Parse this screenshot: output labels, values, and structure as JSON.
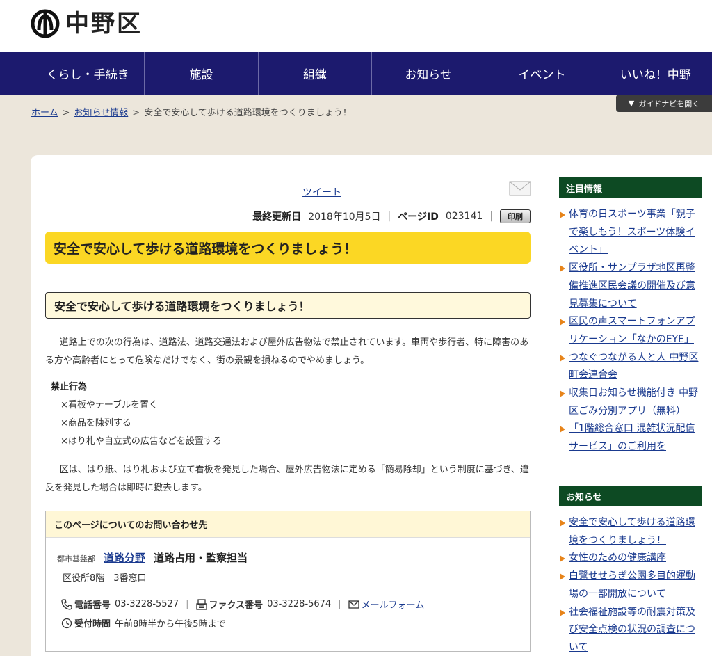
{
  "site": {
    "name": "中野区"
  },
  "nav": {
    "items": [
      {
        "label": "くらし・手続き"
      },
      {
        "label": "施設"
      },
      {
        "label": "組織"
      },
      {
        "label": "お知らせ"
      },
      {
        "label": "イベント"
      },
      {
        "label": "いいね！中野"
      }
    ]
  },
  "guide": {
    "label": "ガイドナビを開く"
  },
  "breadcrumb": {
    "home": "ホーム",
    "notices": "お知らせ情報",
    "current": "安全で安心して歩ける道路環境をつくりましょう！",
    "sep": ">"
  },
  "share": {
    "tweet": "ツイート"
  },
  "meta": {
    "updated_label": "最終更新日",
    "updated_value": "2018年10月5日",
    "page_id_label": "ページID",
    "page_id_value": "023141",
    "print": "印刷",
    "bar": "|"
  },
  "article": {
    "title": "安全で安心して歩ける道路環境をつくりましょう！",
    "heading": "安全で安心して歩ける道路環境をつくりましょう！",
    "p1": "道路上での次の行為は、道路法、道路交通法および屋外広告物法で禁止されています。車両や歩行者、特に障害のある方や高齢者にとって危険なだけでなく、街の景観を損ねるのでやめましょう。",
    "banned_heading": "禁止行為",
    "banned": [
      "×看板やテーブルを置く",
      "×商品を陳列する",
      "×はり札や自立式の広告などを設置する"
    ],
    "p2": "区は、はり紙、はり札および立て看板を発見した場合、屋外広告物法に定める「簡易除却」という制度に基づき、違反を発見した場合は即時に撤去します。"
  },
  "contact": {
    "heading": "このページについてのお問い合わせ先",
    "dept": "都市基盤部",
    "section": "道路分野",
    "sub": "道路占用・監察担当",
    "floor": "区役所8階　3番窓口",
    "tel_label": "電話番号",
    "tel": "03-3228-5527",
    "fax_label": "ファクス番号",
    "fax": "03-3228-5674",
    "mail": "メールフォーム",
    "hours_label": "受付時間",
    "hours": "午前8時半から午後5時まで",
    "bar": "|"
  },
  "sidebar": {
    "featured": {
      "heading": "注目情報",
      "items": [
        {
          "label": "体育の日スポーツ事業「親子で楽しもう！スポーツ体験イベント」"
        },
        {
          "label": "区役所・サンプラザ地区再整備推進区民会議の開催及び意見募集について"
        },
        {
          "label": "区民の声スマートフォンアプリケーション「なかのEYE」"
        },
        {
          "label": "つなぐつながる人と人 中野区町会連合会"
        },
        {
          "label": "収集日お知らせ機能付き 中野区ごみ分別アプリ（無料）"
        },
        {
          "label": "「1階総合窓口 混雑状況配信サービス」のご利用を"
        }
      ]
    },
    "news": {
      "heading": "お知らせ",
      "items": [
        {
          "label": "安全で安心して歩ける道路環境をつくりましょう！"
        },
        {
          "label": "女性のための健康講座"
        },
        {
          "label": "白鷺せせらぎ公園多目的運動場の一部開放について"
        },
        {
          "label": "社会福祉施設等の耐震対策及び安全点検の状況の調査について"
        }
      ]
    }
  },
  "colors": {
    "nav": "#1c1a6e",
    "title_bg": "#fbd724",
    "side_heading": "#0d4a23",
    "arrow": "#e7841a",
    "page_bg": "#ece6db"
  }
}
